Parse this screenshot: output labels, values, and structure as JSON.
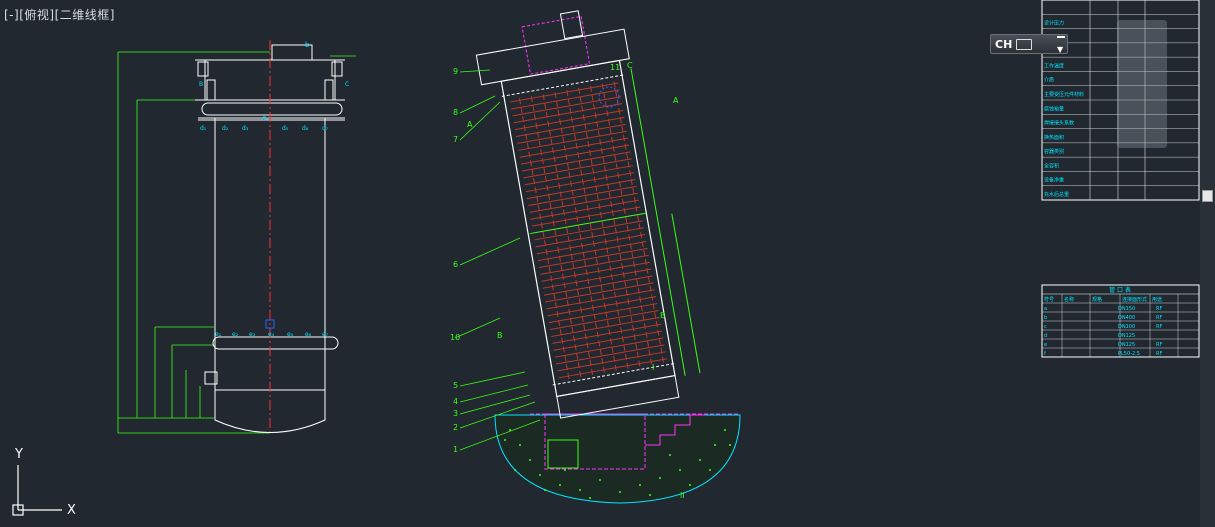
{
  "viewport": {
    "label_parts": [
      "[-]",
      "[俯视]",
      "[二维线框]"
    ],
    "background": "#212830"
  },
  "ucs": {
    "y_label": "Y",
    "x_label": "X"
  },
  "ime": {
    "lang": "CH"
  },
  "left_view": {
    "top_label": "b",
    "nozzle_labels_top": [
      "d₁",
      "d₂",
      "d₃",
      "d₄",
      "d₅",
      "d₆",
      "d₇"
    ],
    "nozzle_labels_bottom": [
      "e₁",
      "e₂",
      "e₃",
      "e₄",
      "e₅",
      "e₆",
      "e₇"
    ],
    "side_labels": [
      "B",
      "C"
    ]
  },
  "right_view": {
    "callouts": [
      "1",
      "2",
      "3",
      "4",
      "5",
      "6",
      "7",
      "8",
      "9",
      "10",
      "11"
    ],
    "section_labels": [
      "A",
      "A",
      "B",
      "B",
      "C"
    ],
    "leader_notes": [
      "I",
      "II"
    ]
  },
  "title_block": {
    "rows": [
      "设计压力",
      "工作压力",
      "设计温度",
      "工作温度",
      "介质",
      "主要受压元件材料",
      "腐蚀裕量",
      "焊接接头系数",
      "换热面积",
      "容器类别",
      "全容积",
      "设备净重",
      "充水后总重"
    ]
  },
  "nozzle_table": {
    "title": "管 口 表",
    "headers": [
      "符号",
      "名称",
      "规格",
      "连接面形式",
      "用途"
    ],
    "rows": [
      {
        "sym": "a",
        "spec": "DN150",
        "face": "RF"
      },
      {
        "sym": "b",
        "spec": "DN400",
        "face": "RF"
      },
      {
        "sym": "c",
        "spec": "DN100",
        "face": "RF"
      },
      {
        "sym": "d",
        "spec": "DN125",
        "face": ""
      },
      {
        "sym": "e",
        "spec": "DN125",
        "face": "RF"
      },
      {
        "sym": "f",
        "spec": "PL50-2.5",
        "face": "RF"
      }
    ]
  },
  "colors": {
    "line": "#ffffff",
    "dim": "#39ff14",
    "center": "#ff3030",
    "cyan": "#00e5ff",
    "magenta": "#ff33ff",
    "tube": "#c0392b",
    "yellow": "#ffff33",
    "blue": "#3060ff"
  }
}
